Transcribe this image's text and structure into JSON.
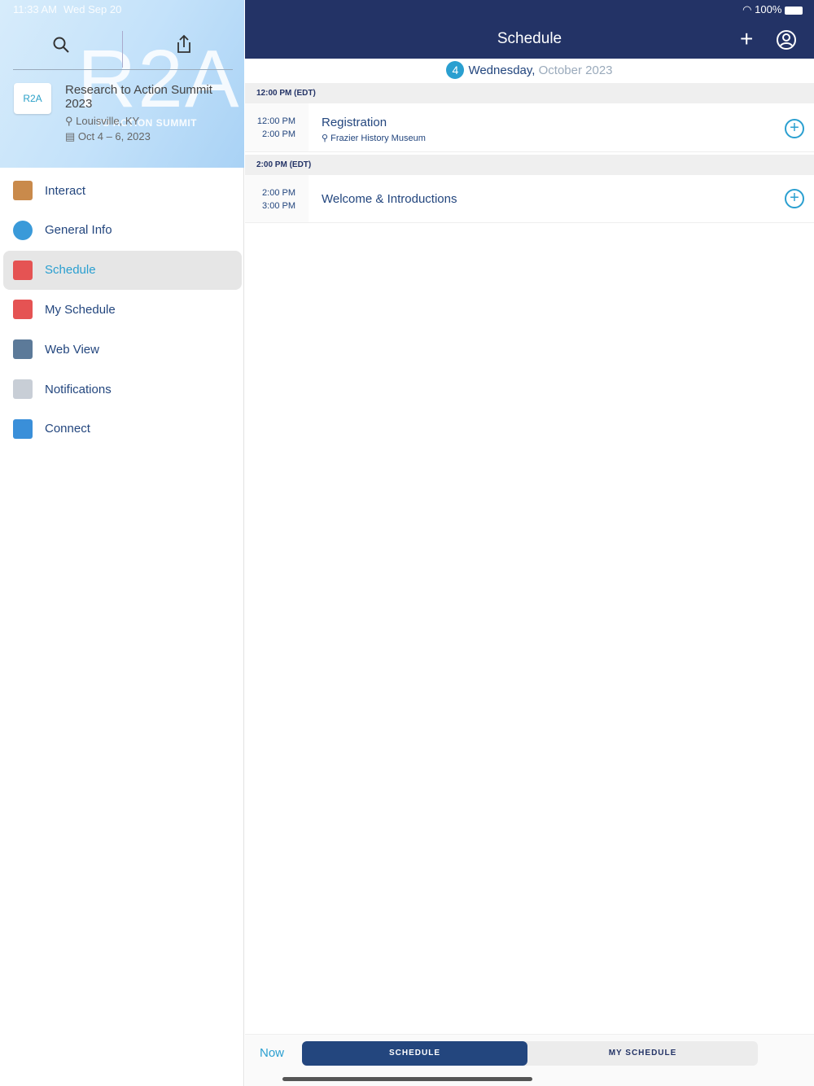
{
  "status": {
    "time": "11:33 AM",
    "date": "Wed Sep 20",
    "battery": "100%"
  },
  "event": {
    "logo_text": "R2A",
    "banner_text": "R2A",
    "banner_subtitle": "TO ACTION SUMMIT",
    "title": "Research to Action Summit 2023",
    "location": "Louisville, KY",
    "dates": "Oct 4 – 6, 2023"
  },
  "sidebar": {
    "items": [
      {
        "label": "Interact",
        "icon": "house-icon",
        "color": "#c98a4b"
      },
      {
        "label": "General Info",
        "icon": "info-icon",
        "color": "#3a9ad9"
      },
      {
        "label": "Schedule",
        "icon": "calendar-icon",
        "color": "#e55353",
        "active": true
      },
      {
        "label": "My Schedule",
        "icon": "my-calendar-icon",
        "color": "#e55353"
      },
      {
        "label": "Web View",
        "icon": "web-view-icon",
        "color": "#5c7a99"
      },
      {
        "label": "Notifications",
        "icon": "envelope-icon",
        "color": "#c8ced6"
      },
      {
        "label": "Connect",
        "icon": "people-icon",
        "color": "#3a8fd9"
      }
    ]
  },
  "header": {
    "title": "Schedule"
  },
  "datebar": {
    "day": "4",
    "weekday": "Wednesday,",
    "month": "October 2023"
  },
  "schedule": [
    {
      "section": "12:00 PM (EDT)",
      "start": "12:00 PM",
      "end": "2:00 PM",
      "title": "Registration",
      "location": "Frazier History Museum"
    },
    {
      "section": "2:00 PM (EDT)",
      "start": "2:00 PM",
      "end": "3:00 PM",
      "title": "Welcome & Introductions"
    }
  ],
  "bottom": {
    "now": "Now",
    "tab_schedule": "SCHEDULE",
    "tab_my_schedule": "MY SCHEDULE"
  },
  "colors": {
    "header": "#233366",
    "accent": "#2a9fd0"
  }
}
